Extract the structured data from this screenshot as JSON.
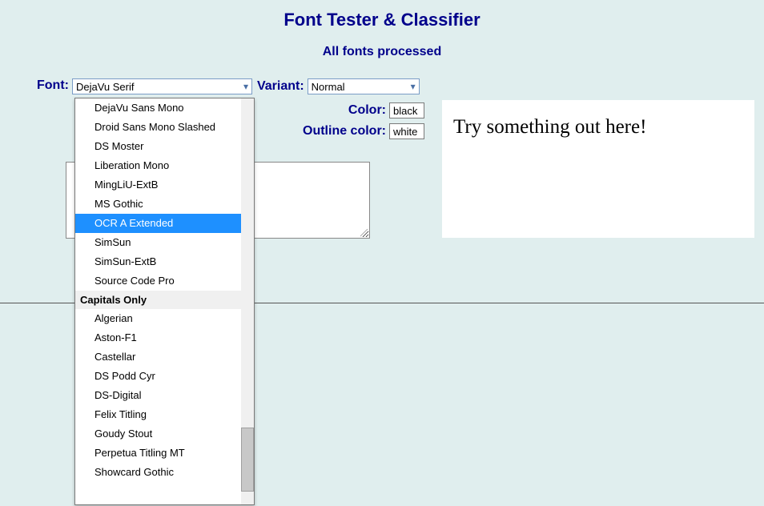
{
  "title": "Font Tester & Classifier",
  "status": "All fonts processed",
  "labels": {
    "font": "Font:",
    "variant": "Variant:",
    "color": "Color:",
    "outline": "Outline color:"
  },
  "font_select": {
    "value": "DejaVu Serif"
  },
  "variant_select": {
    "value": "Normal"
  },
  "color_input": "black",
  "outline_input": "white",
  "preview_text": "Try something out here!",
  "dropdown": {
    "highlighted_index": 6,
    "items": [
      {
        "type": "option",
        "label": "DejaVu Sans Mono"
      },
      {
        "type": "option",
        "label": "Droid Sans Mono Slashed"
      },
      {
        "type": "option",
        "label": "DS Moster"
      },
      {
        "type": "option",
        "label": "Liberation Mono"
      },
      {
        "type": "option",
        "label": "MingLiU-ExtB"
      },
      {
        "type": "option",
        "label": "MS Gothic"
      },
      {
        "type": "option",
        "label": "OCR A Extended"
      },
      {
        "type": "option",
        "label": "SimSun"
      },
      {
        "type": "option",
        "label": "SimSun-ExtB"
      },
      {
        "type": "option",
        "label": "Source Code Pro"
      },
      {
        "type": "group",
        "label": "Capitals Only"
      },
      {
        "type": "option",
        "label": "Algerian"
      },
      {
        "type": "option",
        "label": "Aston-F1"
      },
      {
        "type": "option",
        "label": "Castellar"
      },
      {
        "type": "option",
        "label": "DS Podd Cyr"
      },
      {
        "type": "option",
        "label": "DS-Digital"
      },
      {
        "type": "option",
        "label": "Felix Titling"
      },
      {
        "type": "option",
        "label": "Goudy Stout"
      },
      {
        "type": "option",
        "label": "Perpetua Titling MT"
      },
      {
        "type": "option",
        "label": "Showcard Gothic"
      }
    ]
  }
}
